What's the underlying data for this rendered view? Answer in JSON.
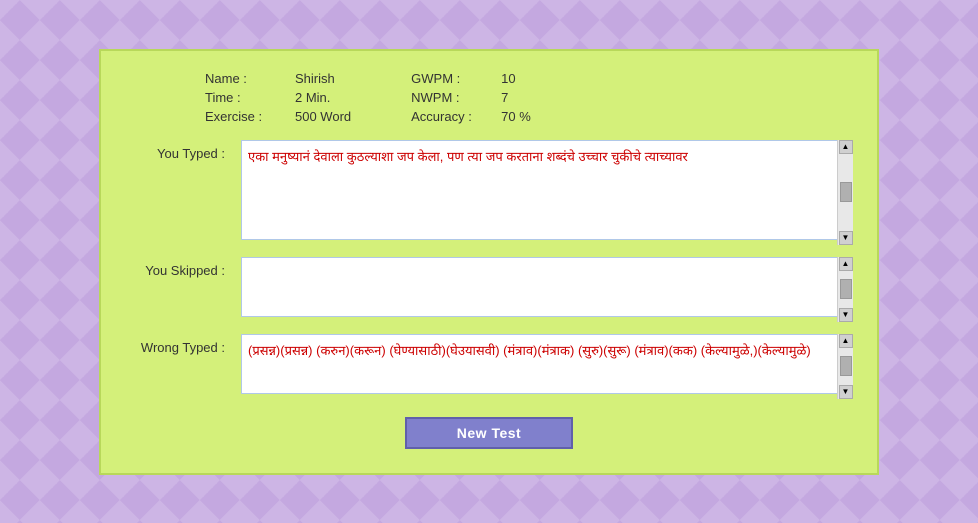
{
  "stats": {
    "name_label": "Name :",
    "name_value": "Shirish",
    "time_label": "Time :",
    "time_value": "2 Min.",
    "exercise_label": "Exercise :",
    "exercise_value": "500 Word",
    "gwpm_label": "GWPM :",
    "gwpm_value": "10",
    "nwpm_label": "NWPM :",
    "nwpm_value": "7",
    "accuracy_label": "Accuracy :",
    "accuracy_value": "70 %"
  },
  "rows": {
    "you_typed_label": "You Typed :",
    "you_typed_content": "एका मनुष्यानं देवाला कुठल्याशा जप केला, पण त्या जप करताना शब्दंचे उच्चार चुकीचे त्याच्यावर",
    "you_skipped_label": "You Skipped :",
    "you_skipped_content": "",
    "wrong_typed_label": "Wrong Typed :",
    "wrong_typed_content": "(प्रसन्न)(प्रसन्न) (करुन)(करून) (घेण्यासाठी)(घेउयासवी) (मंत्राव)(मंत्राक) (सुरु)(सुरू) (मंत्राव)(कक) (केल्यामुळे,)(केल्यामुळे)"
  },
  "button": {
    "new_test_label": "New Test"
  }
}
